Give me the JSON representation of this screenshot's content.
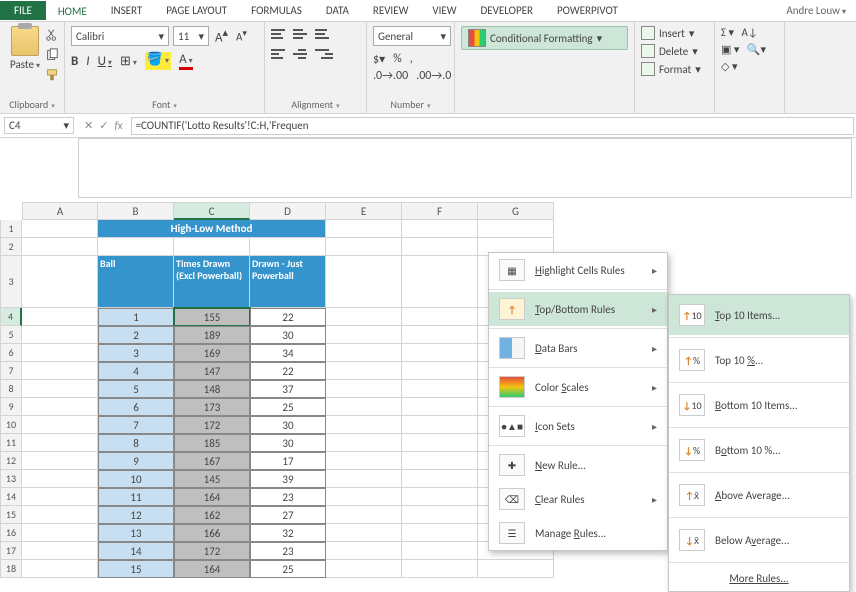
{
  "tabs": {
    "file": "FILE",
    "home": "HOME",
    "insert": "INSERT",
    "pagelayout": "PAGE LAYOUT",
    "formulas": "FORMULAS",
    "data": "DATA",
    "review": "REVIEW",
    "view": "VIEW",
    "developer": "DEVELOPER",
    "powerpivot": "POWERPIVOT",
    "user": "Andre Louw"
  },
  "ribbon": {
    "paste": "Paste",
    "clipboard": "Clipboard",
    "font": "Font",
    "alignment": "Alignment",
    "number": "Number",
    "font_name": "Calibri",
    "font_size": "11",
    "number_format": "General",
    "cf": "Conditional Formatting",
    "insert": "Insert",
    "delete": "Delete",
    "format": "Format"
  },
  "namebox": "C4",
  "formula": "=COUNTIF('Lotto Results'!C:H,'Frequen",
  "columns": [
    "A",
    "B",
    "C",
    "D",
    "E",
    "F",
    "G"
  ],
  "table": {
    "title": "High-Low Method",
    "headers": {
      "ball": "Ball",
      "times": "Times Drawn (Excl Powerball)",
      "drawn": "Drawn - Just Powerball"
    },
    "rows": [
      {
        "r": 4,
        "ball": 1,
        "times": 155,
        "drawn": 22
      },
      {
        "r": 5,
        "ball": 2,
        "times": 189,
        "drawn": 30
      },
      {
        "r": 6,
        "ball": 3,
        "times": 169,
        "drawn": 34
      },
      {
        "r": 7,
        "ball": 4,
        "times": 147,
        "drawn": 22
      },
      {
        "r": 8,
        "ball": 5,
        "times": 148,
        "drawn": 37
      },
      {
        "r": 9,
        "ball": 6,
        "times": 173,
        "drawn": 25
      },
      {
        "r": 10,
        "ball": 7,
        "times": 172,
        "drawn": 30
      },
      {
        "r": 11,
        "ball": 8,
        "times": 185,
        "drawn": 30
      },
      {
        "r": 12,
        "ball": 9,
        "times": 167,
        "drawn": 17
      },
      {
        "r": 13,
        "ball": 10,
        "times": 145,
        "drawn": 39
      },
      {
        "r": 14,
        "ball": 11,
        "times": 164,
        "drawn": 23
      },
      {
        "r": 15,
        "ball": 12,
        "times": 162,
        "drawn": 27
      },
      {
        "r": 16,
        "ball": 13,
        "times": 166,
        "drawn": 32
      },
      {
        "r": 17,
        "ball": 14,
        "times": 172,
        "drawn": 23
      },
      {
        "r": 18,
        "ball": 15,
        "times": 164,
        "drawn": 25
      }
    ]
  },
  "cf_menu": {
    "highlight": "Highlight Cells Rules",
    "topbottom": "Top/Bottom Rules",
    "databars": "Data Bars",
    "colorscales": "Color Scales",
    "iconsets": "Icon Sets",
    "newrule": "New Rule...",
    "clear": "Clear Rules",
    "manage": "Manage Rules..."
  },
  "tb_menu": {
    "top10items": "Top 10 Items...",
    "top10pct": "Top 10 %...",
    "bottom10items": "Bottom 10 Items...",
    "bottom10pct": "Bottom 10 %...",
    "above": "Above Average...",
    "below": "Below Average...",
    "more": "More Rules..."
  }
}
